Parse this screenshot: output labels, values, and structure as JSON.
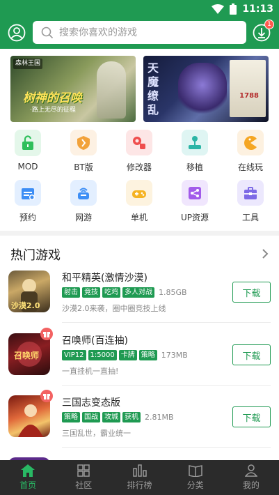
{
  "status_bar": {
    "time": "11:13"
  },
  "colors": {
    "primary": "#1f9a52",
    "accent_badge": "#ff5a4e",
    "nav_active": "#29b864"
  },
  "header": {
    "search_placeholder": "搜索你喜欢的游戏",
    "download_badge": "1",
    "icons": [
      "profile-icon",
      "search-icon",
      "download-icon"
    ]
  },
  "banners": [
    {
      "tag": "森林王国",
      "title": "树神的召唤",
      "subtitle": "·路上无尽的征程"
    },
    {
      "title": "天魔缭乱",
      "price_text": "1788"
    }
  ],
  "categories": [
    {
      "label": "MOD",
      "icon": "unlock-icon",
      "bg": "#e4f7ea",
      "fg": "#2fbf5b"
    },
    {
      "label": "BT版",
      "icon": "bt-shield-icon",
      "bg": "#fdf1e3",
      "fg": "#f2a23a"
    },
    {
      "label": "修改器",
      "icon": "modifier-icon",
      "bg": "#fde6e6",
      "fg": "#ef4e4e"
    },
    {
      "label": "移植",
      "icon": "joystick-icon",
      "bg": "#dff5f3",
      "fg": "#2bb5a6"
    },
    {
      "label": "在线玩",
      "icon": "pacman-icon",
      "bg": "#fdf1e0",
      "fg": "#f5a623"
    },
    {
      "label": "预约",
      "icon": "calendar-icon",
      "bg": "#e3efff",
      "fg": "#3d8ef5"
    },
    {
      "label": "网游",
      "icon": "network-game-icon",
      "bg": "#e3efff",
      "fg": "#3d8ef5"
    },
    {
      "label": "单机",
      "icon": "gamepad-icon",
      "bg": "#fdf3df",
      "fg": "#f5b323"
    },
    {
      "label": "UP资源",
      "icon": "share-icon",
      "bg": "#f0e6fd",
      "fg": "#a25bea"
    },
    {
      "label": "工具",
      "icon": "toolbox-icon",
      "bg": "#ece8fd",
      "fg": "#7d6ae6"
    }
  ],
  "hot_games": {
    "title": "热门游戏",
    "items": [
      {
        "name": "和平精英(激情沙漠)",
        "tags": [
          "射击",
          "竞技",
          "吃鸡",
          "多人对战"
        ],
        "size": "1.85GB",
        "desc": "沙漠2.0来袭，圈中圈竞技上线",
        "download_label": "下载",
        "thumb_overlay": "沙漠2.0",
        "has_gift": false
      },
      {
        "name": "召唤师(百连抽)",
        "tags": [
          "VIP12",
          "1:5000",
          "卡牌",
          "策略"
        ],
        "size": "173MB",
        "desc": "一直挂机一直抽!",
        "download_label": "下载",
        "thumb_overlay": "召唤师",
        "has_gift": true
      },
      {
        "name": "三国志变态版",
        "tags": [
          "策略",
          "国战",
          "攻城",
          "获机"
        ],
        "size": "2.81MB",
        "desc": "三国乱世，霸业统一",
        "download_label": "下载",
        "thumb_overlay": "",
        "has_gift": true
      }
    ]
  },
  "bottom_nav": [
    {
      "label": "首页",
      "icon": "home-icon",
      "active": true
    },
    {
      "label": "社区",
      "icon": "community-icon",
      "active": false
    },
    {
      "label": "排行榜",
      "icon": "ranking-icon",
      "active": false
    },
    {
      "label": "分类",
      "icon": "category-icon",
      "active": false
    },
    {
      "label": "我的",
      "icon": "user-icon",
      "active": false
    }
  ]
}
